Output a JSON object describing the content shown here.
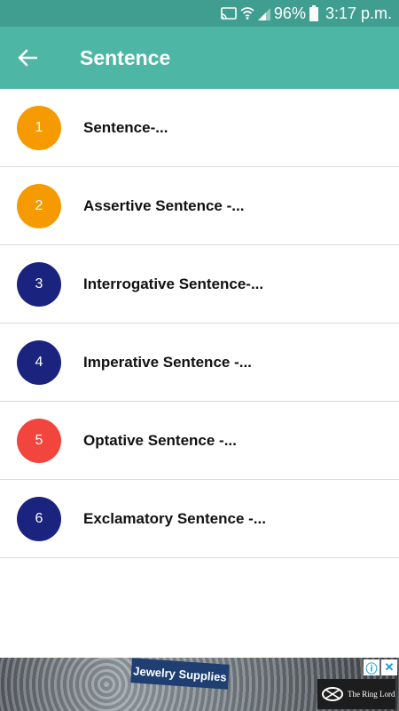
{
  "status_bar": {
    "battery": "96%",
    "time": "3:17 p.m."
  },
  "app_bar": {
    "title": "Sentence"
  },
  "items": [
    {
      "number": "1",
      "label": "Sentence-...",
      "color": "#f59a00"
    },
    {
      "number": "2",
      "label": "Assertive Sentence -...",
      "color": "#f59a00"
    },
    {
      "number": "3",
      "label": "Interrogative Sentence-...",
      "color": "#1a237e"
    },
    {
      "number": "4",
      "label": "Imperative Sentence -...",
      "color": "#1a237e"
    },
    {
      "number": "5",
      "label": "Optative Sentence -...",
      "color": "#f2453d"
    },
    {
      "number": "6",
      "label": "Exclamatory Sentence -...",
      "color": "#1a237e"
    }
  ],
  "ad": {
    "tag": "Jewelry Supplies",
    "logo_text": "The Ring Lord",
    "info_icon": "ⓘ",
    "close_icon": "✕"
  },
  "colors": {
    "status_bar_bg": "#3f9e8f",
    "app_bar_bg": "#4db6a5"
  }
}
